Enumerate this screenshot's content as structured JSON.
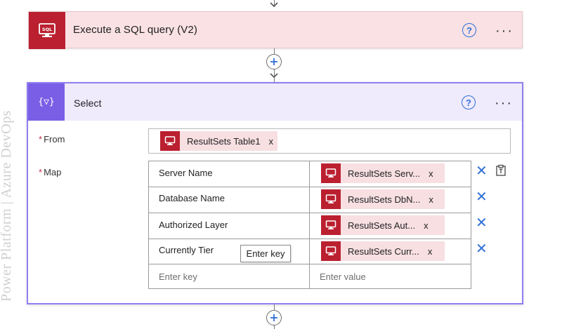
{
  "watermark": "Power Platform | Azure DevOps",
  "sql_action": {
    "title": "Execute a SQL query (V2)",
    "icon_label": "SQL",
    "help_glyph": "?",
    "more_glyph": "···"
  },
  "select_action": {
    "title": "Select",
    "icon_glyph": "{▽}",
    "help_glyph": "?",
    "more_glyph": "···",
    "from": {
      "label": "From",
      "required_mark": "*",
      "token": "ResultSets Table1",
      "token_close": "x"
    },
    "map": {
      "label": "Map",
      "required_mark": "*",
      "rows": [
        {
          "key": "Server Name",
          "value": "ResultSets Serv...",
          "close": "x",
          "delete": "✕"
        },
        {
          "key": "Database Name",
          "value": "ResultSets DbN...",
          "close": "x",
          "delete": "✕"
        },
        {
          "key": "Authorized Layer",
          "value": "ResultSets Aut...",
          "close": "x",
          "delete": "✕"
        },
        {
          "key": "Currently Tier",
          "value": "ResultSets Curr...",
          "close": "x",
          "delete": "✕"
        }
      ],
      "key_placeholder": "Enter key",
      "value_placeholder": "Enter value",
      "tooltip": "Enter key"
    }
  },
  "add_step_glyph": "+",
  "colors": {
    "sql_brand": "#bb2030",
    "select_brand": "#7a5ee6",
    "select_border": "#8f7ef1",
    "link_blue": "#2f6fd6"
  }
}
